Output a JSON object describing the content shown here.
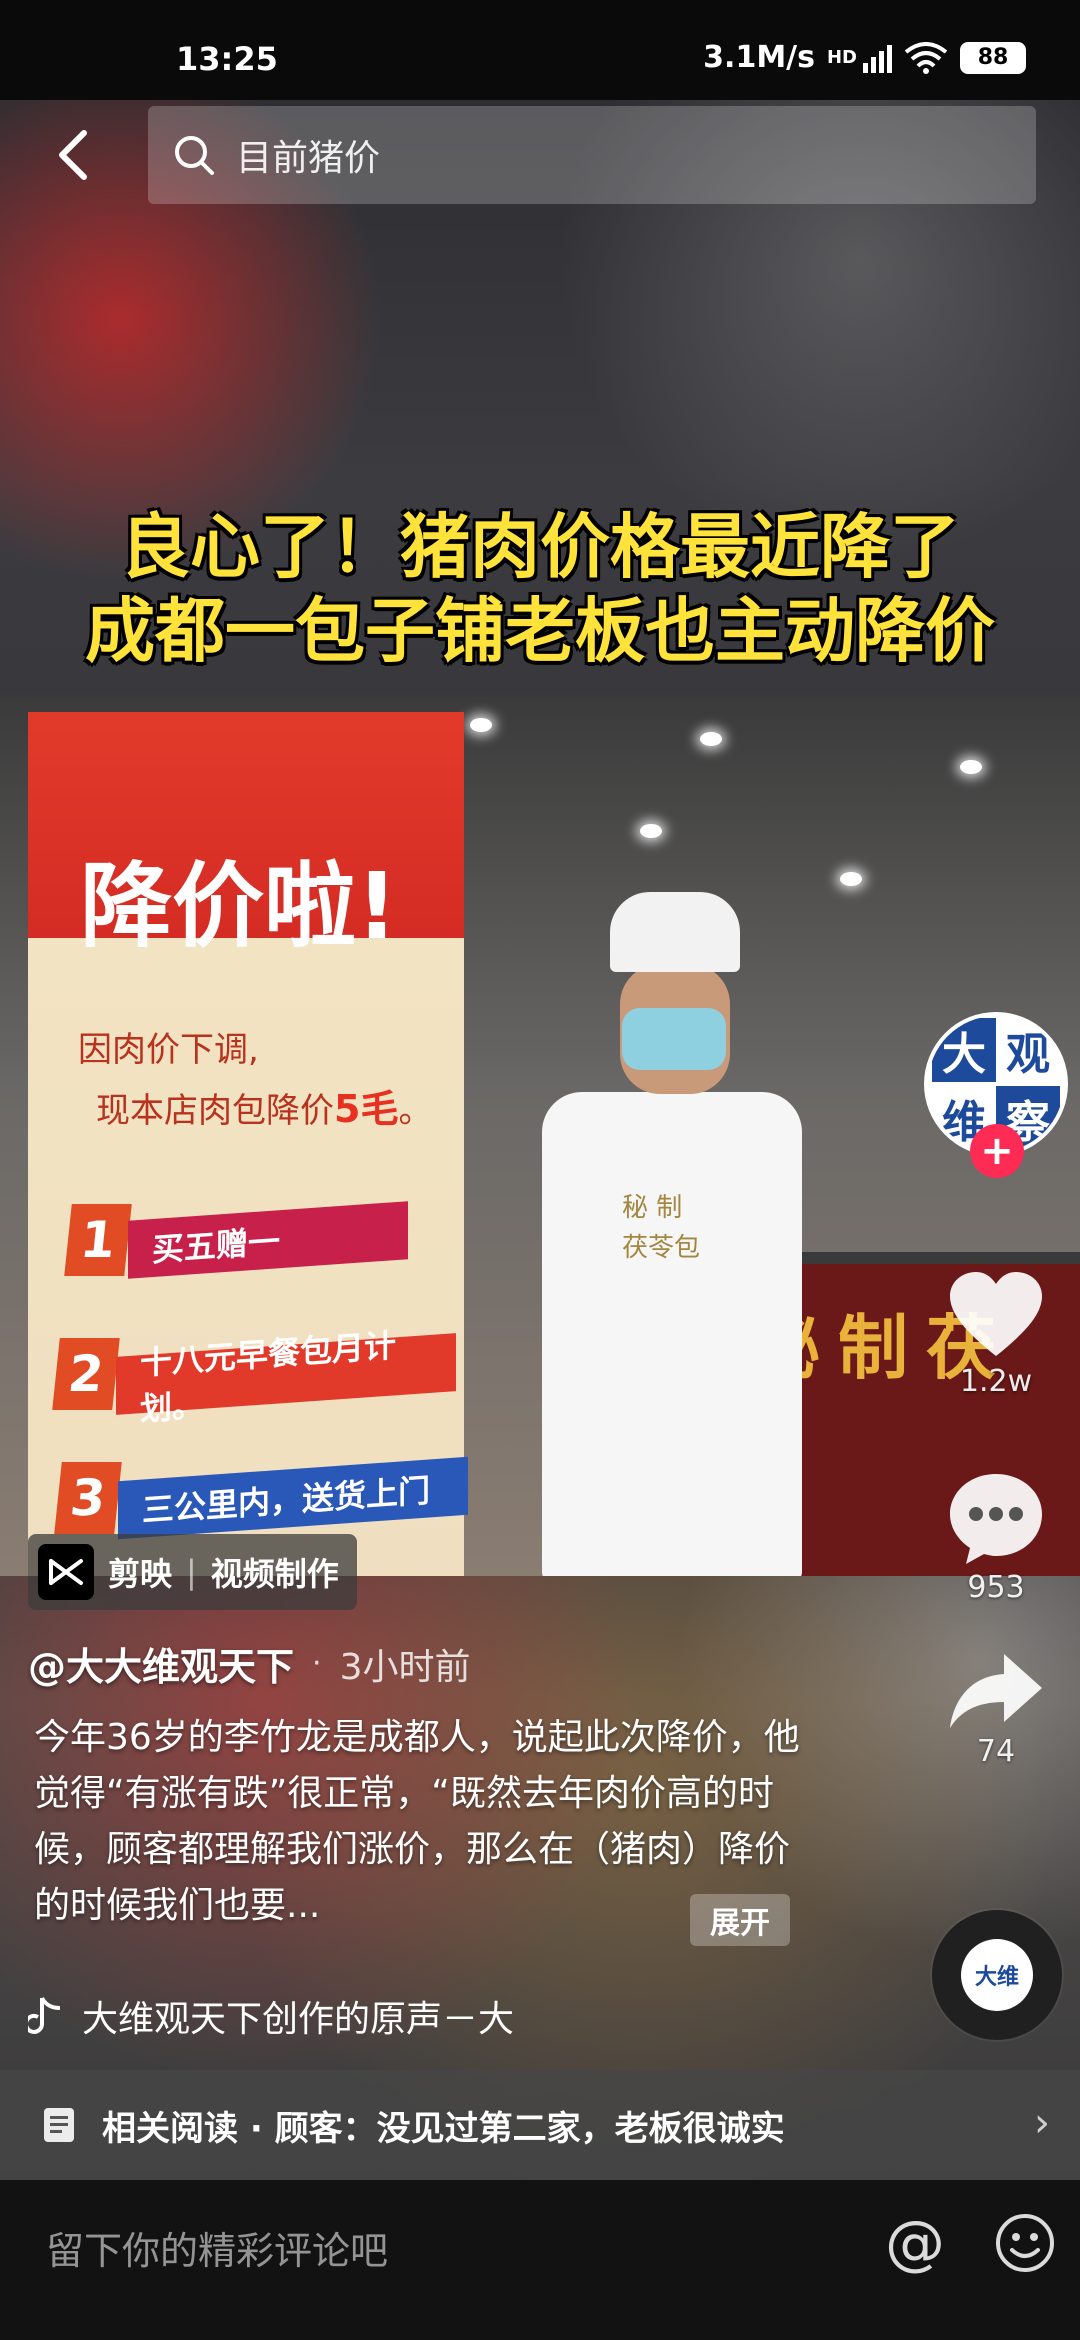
{
  "status_bar": {
    "time": "13:25",
    "network_speed": "3.1M/s",
    "network_type": "HD",
    "battery": "88"
  },
  "search": {
    "query": "目前猪价"
  },
  "video": {
    "headline_line1": "良心了！猪肉价格最近降了",
    "headline_line2": "成都一包子铺老板也主动降价",
    "banner_title": "降价啦!",
    "banner_sub1": "因肉价下调,",
    "banner_sub2_prefix": "现本店肉包降价",
    "banner_sub2_amount": "5毛",
    "banner_sub2_suffix": "。",
    "promos": [
      {
        "num": "1",
        "text": "买五赠一"
      },
      {
        "num": "2",
        "text": "十八元早餐包月计划。"
      },
      {
        "num": "3",
        "text": "三公里内，送货上门"
      }
    ],
    "apron_text_1": "秘 制",
    "apron_text_2": "茯苓包",
    "shop_sign": "秘制茯"
  },
  "watermark": {
    "app": "剪映",
    "divider": "|",
    "label": "视频制作"
  },
  "rail": {
    "avatar_chars": [
      "大",
      "观",
      "维",
      "察"
    ],
    "like_count": "1.2w",
    "comment_count": "953",
    "share_count": "74"
  },
  "post": {
    "author": "@大大维观天下",
    "dot": "·",
    "time": "3小时前",
    "caption": "今年36岁的李竹龙是成都人，说起此次降价，他觉得“有涨有跌”很正常，“既然去年肉价高的时候，顾客都理解我们涨价，那么在（猪肉）降价的时候我们也要...",
    "expand_label": "展开",
    "music": "大维观天下创作的原声－大"
  },
  "related": {
    "text": "相关阅读 · 顾客：没见过第二家，老板很诚实"
  },
  "comment": {
    "placeholder": "留下你的精彩评论吧"
  },
  "colors": {
    "accent_red": "#fe2c55",
    "headline_yellow": "#ffe23a",
    "brand_blue": "#1d4a9a"
  }
}
